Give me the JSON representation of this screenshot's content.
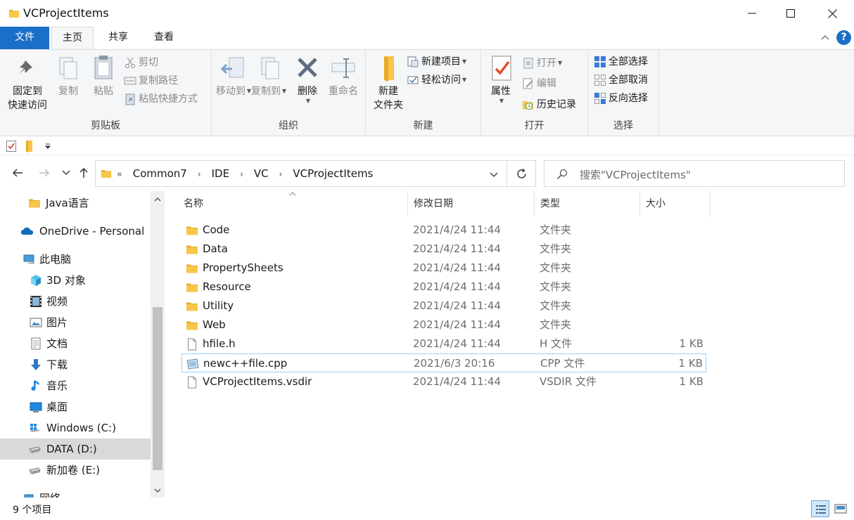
{
  "window": {
    "title": "VCProjectItems"
  },
  "ribbon_tabs": [
    "文件",
    "主页",
    "共享",
    "查看"
  ],
  "ribbon": {
    "clipboard": {
      "label": "剪贴板",
      "pin_line1": "固定到",
      "pin_line2": "快速访问",
      "copy": "复制",
      "paste": "粘贴",
      "cut": "剪切",
      "copy_path": "复制路径",
      "paste_shortcut": "粘贴快捷方式"
    },
    "organize": {
      "label": "组织",
      "move_to": "移动到",
      "copy_to": "复制到",
      "delete": "删除",
      "rename": "重命名"
    },
    "new": {
      "label": "新建",
      "new_folder_line1": "新建",
      "new_folder_line2": "文件夹",
      "new_item": "新建项目",
      "easy_access": "轻松访问"
    },
    "open": {
      "label": "打开",
      "properties": "属性",
      "open": "打开",
      "edit": "编辑",
      "history": "历史记录"
    },
    "select": {
      "label": "选择",
      "select_all": "全部选择",
      "select_none": "全部取消",
      "invert": "反向选择"
    }
  },
  "address": {
    "crumbs": [
      "«",
      "Common7",
      "IDE",
      "VC",
      "VCProjectItems"
    ],
    "separator": "›",
    "search_placeholder": "搜索\"VCProjectItems\""
  },
  "sidebar": {
    "items": [
      {
        "label": "Java语言",
        "icon": "folder-icon"
      },
      {
        "label": "OneDrive - Personal",
        "icon": "cloud-icon"
      },
      {
        "label": "此电脑",
        "icon": "computer-icon"
      },
      {
        "label": "3D 对象",
        "icon": "cube-icon"
      },
      {
        "label": "视频",
        "icon": "film-icon"
      },
      {
        "label": "图片",
        "icon": "picture-icon"
      },
      {
        "label": "文档",
        "icon": "document-icon"
      },
      {
        "label": "下载",
        "icon": "download-icon"
      },
      {
        "label": "音乐",
        "icon": "music-icon"
      },
      {
        "label": "桌面",
        "icon": "desktop-icon"
      },
      {
        "label": "Windows (C:)",
        "icon": "windows-drive-icon"
      },
      {
        "label": "DATA (D:)",
        "icon": "drive-icon"
      },
      {
        "label": "新加卷 (E:)",
        "icon": "drive-icon"
      },
      {
        "label": "网络",
        "icon": "network-icon"
      }
    ]
  },
  "columns": {
    "name": "名称",
    "date": "修改日期",
    "type": "类型",
    "size": "大小"
  },
  "files": [
    {
      "name": "Code",
      "date": "2021/4/24 11:44",
      "type": "文件夹",
      "size": "",
      "icon": "folder-icon"
    },
    {
      "name": "Data",
      "date": "2021/4/24 11:44",
      "type": "文件夹",
      "size": "",
      "icon": "folder-icon"
    },
    {
      "name": "PropertySheets",
      "date": "2021/4/24 11:44",
      "type": "文件夹",
      "size": "",
      "icon": "folder-icon"
    },
    {
      "name": "Resource",
      "date": "2021/4/24 11:44",
      "type": "文件夹",
      "size": "",
      "icon": "folder-icon"
    },
    {
      "name": "Utility",
      "date": "2021/4/24 11:44",
      "type": "文件夹",
      "size": "",
      "icon": "folder-icon"
    },
    {
      "name": "Web",
      "date": "2021/4/24 11:44",
      "type": "文件夹",
      "size": "",
      "icon": "folder-icon"
    },
    {
      "name": "hfile.h",
      "date": "2021/4/24 11:44",
      "type": "H 文件",
      "size": "1 KB",
      "icon": "file-icon"
    },
    {
      "name": "newc++file.cpp",
      "date": "2021/6/3 20:16",
      "type": "CPP 文件",
      "size": "1 KB",
      "icon": "cpp-file-icon"
    },
    {
      "name": "VCProjectItems.vsdir",
      "date": "2021/4/24 11:44",
      "type": "VSDIR 文件",
      "size": "1 KB",
      "icon": "file-icon"
    }
  ],
  "status": {
    "count": "9 个项目"
  },
  "colors": {
    "accent": "#1a6fc9",
    "folder": "#f8c64a",
    "selection_border": "#99d1ff"
  }
}
